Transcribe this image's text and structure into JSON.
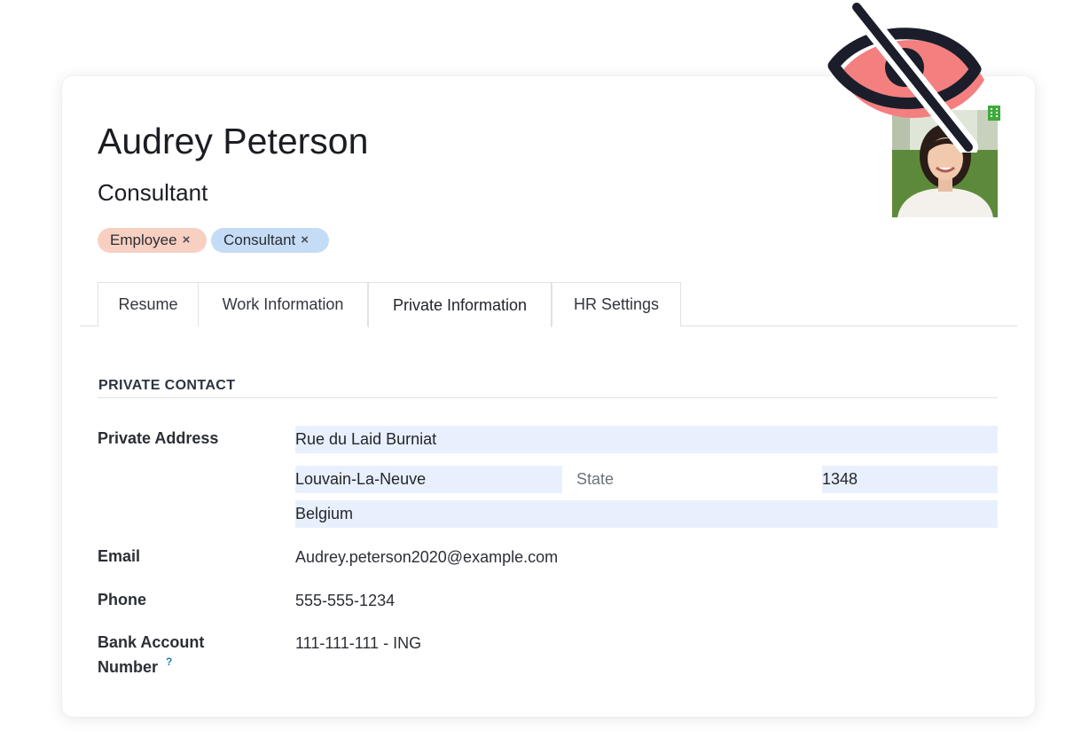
{
  "employee": {
    "name": "Audrey Peterson",
    "job_title": "Consultant"
  },
  "tags": [
    {
      "label": "Employee",
      "remove": "×",
      "color": "#f7d0c2"
    },
    {
      "label": "Consultant",
      "remove": "×",
      "color": "#c5dcf6"
    }
  ],
  "tabs": [
    {
      "label": "Resume"
    },
    {
      "label": "Work Information"
    },
    {
      "label": "Private Information",
      "active": true
    },
    {
      "label": "HR Settings"
    }
  ],
  "private_contact": {
    "section_title": "PRIVATE CONTACT",
    "address": {
      "label": "Private Address",
      "street": "Rue du Laid Burniat",
      "city": "Louvain-La-Neuve",
      "state_placeholder": "State",
      "zip": "1348",
      "country": "Belgium"
    },
    "email": {
      "label": "Email",
      "value": "Audrey.peterson2020@example.com"
    },
    "phone": {
      "label": "Phone",
      "value": "555-555-1234"
    },
    "bank": {
      "label_line1": "Bank Account",
      "label_line2": "Number",
      "help": "?",
      "value": "111-111-111 - ING"
    }
  },
  "icons": {
    "overlay": "eye-slash-icon",
    "status": "building-icon"
  },
  "colors": {
    "field_bg": "#e9f0fd",
    "eye_accent": "#f47f7f",
    "status_green": "#3cab3c"
  }
}
